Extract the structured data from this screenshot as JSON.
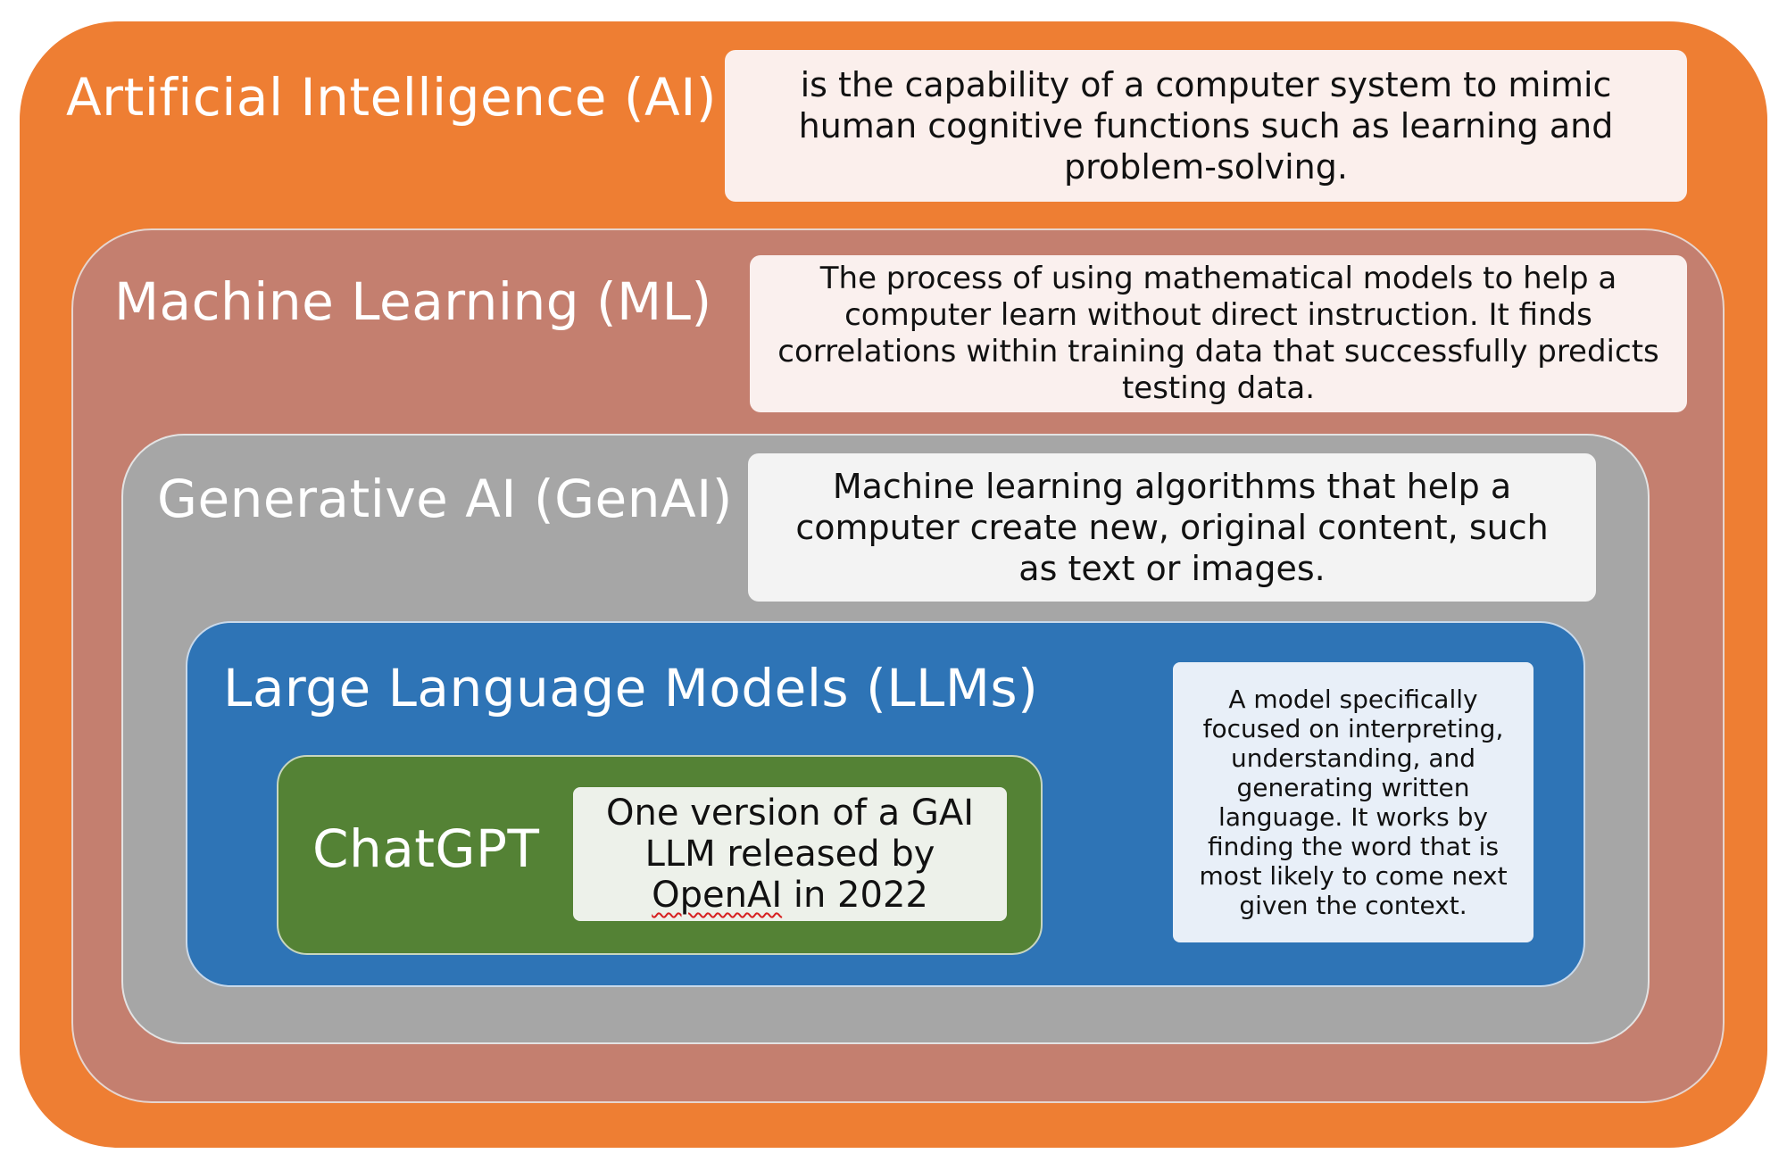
{
  "colors": {
    "ai": "#ee7e33",
    "ml": "#c47f6f",
    "genai": "#a6a6a6",
    "llm": "#2e74b6",
    "chatgpt": "#548235"
  },
  "ai": {
    "title": "Artificial Intelligence (AI)",
    "description": "is the capability of a computer system to mimic human cognitive functions such as learning and problem-solving."
  },
  "ml": {
    "title": "Machine Learning (ML)",
    "description": "The process of using mathematical models to help a computer learn without direct instruction. It finds correlations within training data that successfully predicts testing data."
  },
  "genai": {
    "title": "Generative AI (GenAI)",
    "description": "Machine learning algorithms that help a computer create new, original content, such as text or images."
  },
  "llm": {
    "title": "Large Language Models (LLMs)",
    "description": "A model specifically focused on interpreting, understanding, and generating written language. It works by finding the word that is most likely to come next given the context."
  },
  "chatgpt": {
    "title": "ChatGPT",
    "description_before": "One version of a GAI LLM released by",
    "description_brand": "OpenAI",
    "description_after": "in 2022"
  }
}
